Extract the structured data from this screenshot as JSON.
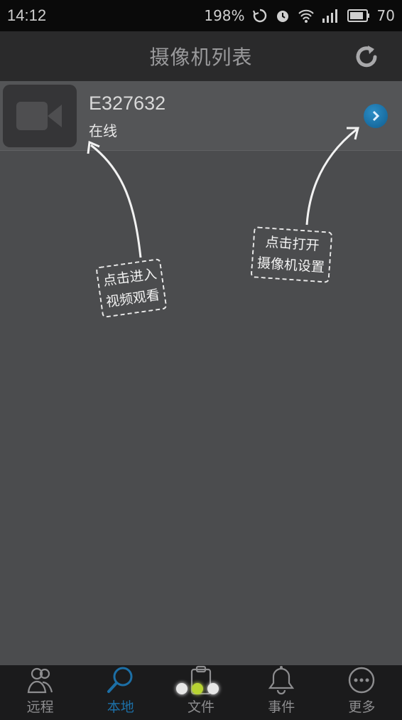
{
  "status_bar": {
    "time": "14:12",
    "speed": "198%",
    "battery": "70"
  },
  "header": {
    "title": "摄像机列表"
  },
  "camera_list": [
    {
      "id": "E327632",
      "status": "在线"
    }
  ],
  "tips": {
    "enter_line1": "点击进入",
    "enter_line2": "视频观看",
    "settings_line1": "点击打开",
    "settings_line2": "摄像机设置"
  },
  "tabs": [
    {
      "label": "远程",
      "icon": "users-icon"
    },
    {
      "label": "本地",
      "icon": "search-icon",
      "active": true
    },
    {
      "label": "文件",
      "icon": "clipboard-icon"
    },
    {
      "label": "事件",
      "icon": "bell-icon"
    },
    {
      "label": "更多",
      "icon": "more-icon"
    }
  ],
  "colors": {
    "accent": "#1c6fa6",
    "background": "#4b4c4e",
    "header": "#2a2a2b"
  }
}
